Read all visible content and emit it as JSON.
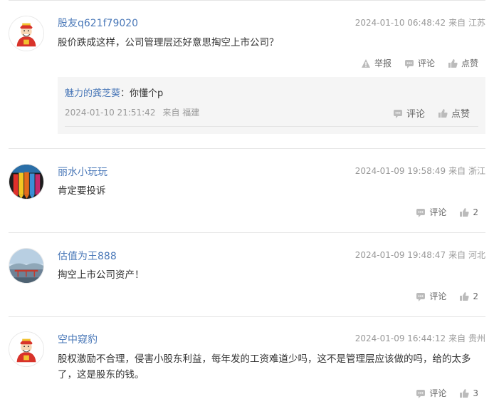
{
  "comments": [
    {
      "username": "股友q621f79020",
      "time": "2024-01-10 06:48:42",
      "location": "来自 江苏",
      "text": "股价跌成这样，公司管理层还好意思掏空上市公司？",
      "actions": {
        "report": "举报",
        "comment": "评论",
        "like": "点赞"
      },
      "reply": {
        "username": "魅力的龚芝葵",
        "colon": "：",
        "text": "你懂个p",
        "time": "2024-01-10 21:51:42",
        "location": "来自 福建",
        "actions": {
          "comment": "评论",
          "like": "点赞"
        }
      }
    },
    {
      "username": "丽水小玩玩",
      "time": "2024-01-09 19:58:49",
      "location": "来自 浙江",
      "text": "肯定要投诉",
      "actions": {
        "comment": "评论",
        "like": "2"
      }
    },
    {
      "username": "估值为王888",
      "time": "2024-01-09 19:48:47",
      "location": "来自 河北",
      "text": "掏空上市公司资产！",
      "actions": {
        "comment": "评论",
        "like": "2"
      }
    },
    {
      "username": "空中窥豹",
      "time": "2024-01-09 16:44:12",
      "location": "来自 贵州",
      "text": "股权激励不合理，侵害小股东利益，每年发的工资难道少吗，这不是管理层应该做的吗，给的太多了，这是股东的钱。",
      "actions": {
        "comment": "评论",
        "like": "3"
      }
    }
  ]
}
